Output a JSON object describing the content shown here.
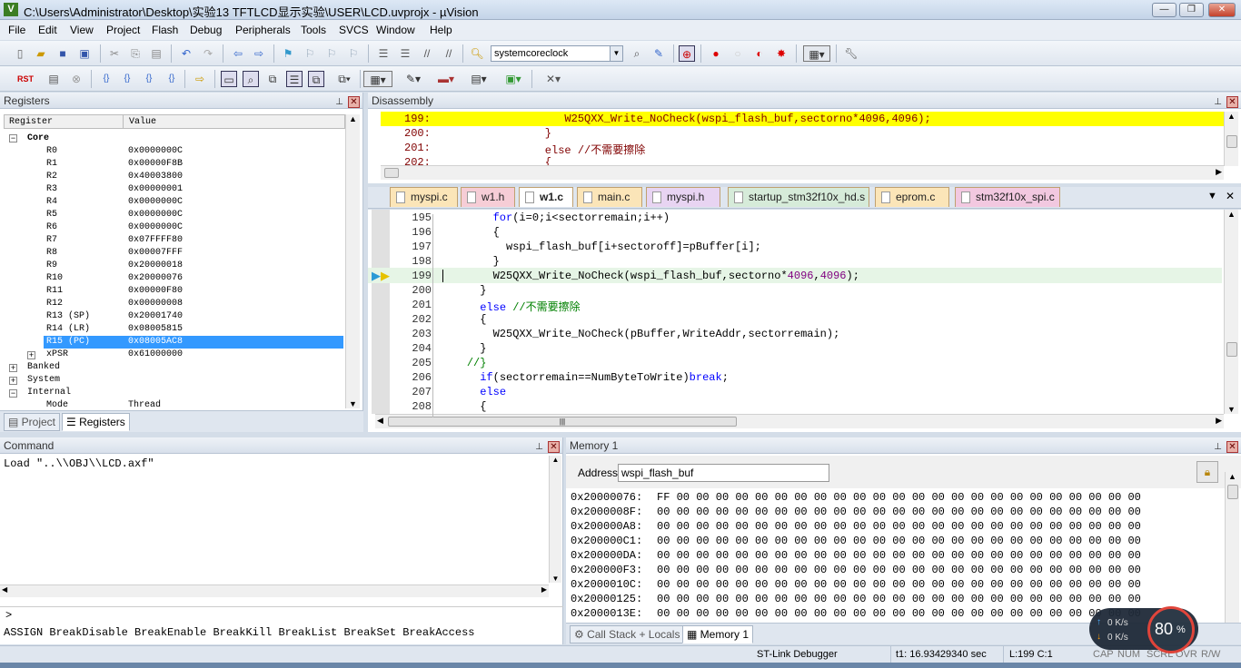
{
  "window": {
    "title": "C:\\Users\\Administrator\\Desktop\\实验13 TFTLCD显示实验\\USER\\LCD.uvprojx - µVision",
    "minimize": "—",
    "maximize": "❐",
    "close": "✕"
  },
  "menu": [
    "File",
    "Edit",
    "View",
    "Project",
    "Flash",
    "Debug",
    "Peripherals",
    "Tools",
    "SVCS",
    "Window",
    "Help"
  ],
  "toolbar": {
    "find_combo_value": "systemcoreclock"
  },
  "registers": {
    "title": "Registers",
    "col_register": "Register",
    "col_value": "Value",
    "core_label": "Core",
    "rows": [
      {
        "name": "R0",
        "value": "0x0000000C"
      },
      {
        "name": "R1",
        "value": "0x00000F8B"
      },
      {
        "name": "R2",
        "value": "0x40003800"
      },
      {
        "name": "R3",
        "value": "0x00000001"
      },
      {
        "name": "R4",
        "value": "0x0000000C"
      },
      {
        "name": "R5",
        "value": "0x0000000C"
      },
      {
        "name": "R6",
        "value": "0x0000000C"
      },
      {
        "name": "R7",
        "value": "0x07FFFF80"
      },
      {
        "name": "R8",
        "value": "0x00007FFF"
      },
      {
        "name": "R9",
        "value": "0x20000018"
      },
      {
        "name": "R10",
        "value": "0x20000076"
      },
      {
        "name": "R11",
        "value": "0x00000F80"
      },
      {
        "name": "R12",
        "value": "0x00000008"
      },
      {
        "name": "R13 (SP)",
        "value": "0x20001740"
      },
      {
        "name": "R14 (LR)",
        "value": "0x08005815"
      },
      {
        "name": "R15 (PC)",
        "value": "0x08005AC8"
      },
      {
        "name": "xPSR",
        "value": "0x61000000"
      }
    ],
    "groups": [
      "Banked",
      "System",
      "Internal"
    ],
    "internal_mode_label": "Mode",
    "internal_mode_value": "Thread"
  },
  "left_tabs": {
    "project": "Project",
    "registers": "Registers"
  },
  "disassembly": {
    "title": "Disassembly",
    "lines": [
      {
        "addr": "199:",
        "text": "            W25QXX_Write_NoCheck(wspi_flash_buf,sectorno*4096,4096);"
      },
      {
        "addr": "200:",
        "text": "         }"
      },
      {
        "addr": "201:",
        "text": "         else //不需要擦除"
      },
      {
        "addr": "202:",
        "text": "         {"
      }
    ]
  },
  "editor_tabs": [
    "myspi.c",
    "w1.h",
    "w1.c",
    "main.c",
    "myspi.h",
    "startup_stm32f10x_hd.s",
    "eprom.c",
    "stm32f10x_spi.c"
  ],
  "editor": {
    "lines": [
      {
        "no": "195",
        "text": "        for(i=0;i<sectorremain;i++)"
      },
      {
        "no": "196",
        "text": "        {"
      },
      {
        "no": "197",
        "text": "          wspi_flash_buf[i+sectoroff]=pBuffer[i];"
      },
      {
        "no": "198",
        "text": "        }"
      },
      {
        "no": "199",
        "text": "        W25QXX_Write_NoCheck(wspi_flash_buf,sectorno*4096,4096);"
      },
      {
        "no": "200",
        "text": "      }"
      },
      {
        "no": "201",
        "text": "      else //不需要擦除"
      },
      {
        "no": "202",
        "text": "      {"
      },
      {
        "no": "203",
        "text": "        W25QXX_Write_NoCheck(pBuffer,WriteAddr,sectorremain);"
      },
      {
        "no": "204",
        "text": "      }"
      },
      {
        "no": "205",
        "text": "    //}"
      },
      {
        "no": "206",
        "text": "      if(sectorremain==NumByteToWrite)break;"
      },
      {
        "no": "207",
        "text": "      else"
      },
      {
        "no": "208",
        "text": "      {"
      }
    ]
  },
  "command": {
    "title": "Command",
    "output": "Load \"..\\\\OBJ\\\\LCD.axf\"",
    "prompt": ">",
    "hints": "ASSIGN BreakDisable BreakEnable BreakKill BreakList BreakSet BreakAccess"
  },
  "memory": {
    "title": "Memory 1",
    "address_label": "Address:",
    "address_value": "wspi_flash_buf",
    "rows": [
      {
        "addr": "0x20000076:",
        "bytes": "FF 00 00 00 00 00 00 00 00 00 00 00 00 00 00 00 00 00 00 00 00 00 00 00 00"
      },
      {
        "addr": "0x2000008F:",
        "bytes": "00 00 00 00 00 00 00 00 00 00 00 00 00 00 00 00 00 00 00 00 00 00 00 00 00"
      },
      {
        "addr": "0x200000A8:",
        "bytes": "00 00 00 00 00 00 00 00 00 00 00 00 00 00 00 00 00 00 00 00 00 00 00 00 00"
      },
      {
        "addr": "0x200000C1:",
        "bytes": "00 00 00 00 00 00 00 00 00 00 00 00 00 00 00 00 00 00 00 00 00 00 00 00 00"
      },
      {
        "addr": "0x200000DA:",
        "bytes": "00 00 00 00 00 00 00 00 00 00 00 00 00 00 00 00 00 00 00 00 00 00 00 00 00"
      },
      {
        "addr": "0x200000F3:",
        "bytes": "00 00 00 00 00 00 00 00 00 00 00 00 00 00 00 00 00 00 00 00 00 00 00 00 00"
      },
      {
        "addr": "0x2000010C:",
        "bytes": "00 00 00 00 00 00 00 00 00 00 00 00 00 00 00 00 00 00 00 00 00 00 00 00 00"
      },
      {
        "addr": "0x20000125:",
        "bytes": "00 00 00 00 00 00 00 00 00 00 00 00 00 00 00 00 00 00 00 00 00 00 00 00 00"
      },
      {
        "addr": "0x2000013E:",
        "bytes": "00 00 00 00 00 00 00 00 00 00 00 00 00 00 00 00 00 00 00 00 00 00 00 00 00"
      }
    ]
  },
  "bottom_tabs": {
    "callstack": "Call Stack + Locals",
    "memory": "Memory 1"
  },
  "statusbar": {
    "debugger": "ST-Link Debugger",
    "time": "t1: 16.93429340 sec",
    "position": "L:199 C:1",
    "caps": "CAP",
    "num": "NUM",
    "scrl": "SCRL",
    "ovr": "OVR",
    "rw": "R/W"
  },
  "netwidget": {
    "up": "0 K/s",
    "down": "0 K/s",
    "percent": "80",
    "percent_sign": "%"
  },
  "colors": {
    "current_line_yellow": "#ffff00",
    "selected_row": "#3399ff",
    "keyword": "#0000ff",
    "comment": "#008000"
  }
}
